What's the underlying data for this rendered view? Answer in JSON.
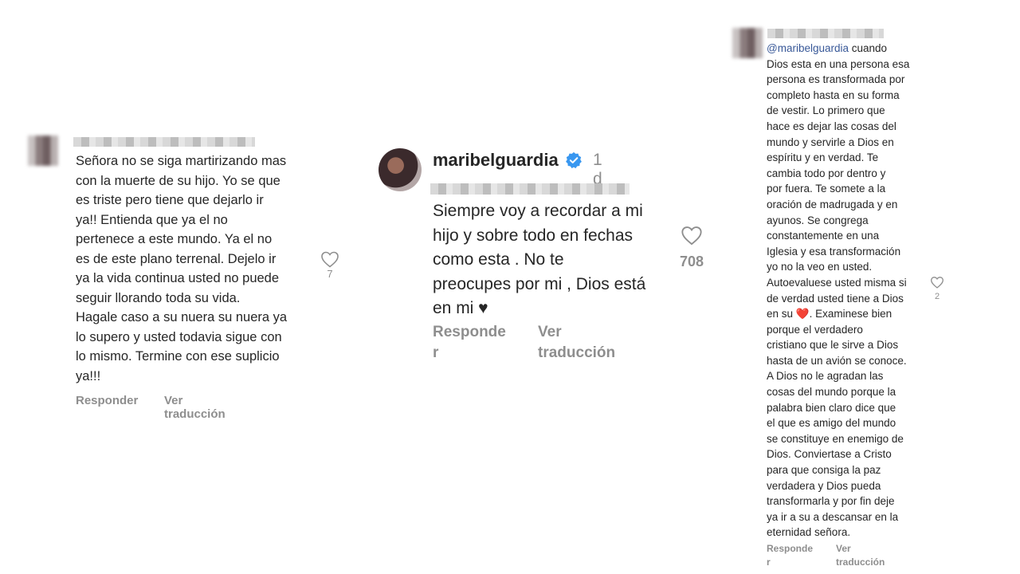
{
  "comment1": {
    "text": "Señora no se siga martirizando mas\ncon la muerte de su hijo. Yo se que\nes triste pero tiene que dejarlo ir\nya!! Entienda que ya el no\npertenece a este mundo. Ya el no\nes de este plano terrenal. Dejelo ir\nya la vida continua usted no puede\nseguir llorando toda su vida.\nHagale caso a su nuera su nuera ya\nlo supero y usted todavia sigue con\nlo mismo. Termine con ese suplicio\nya!!!",
    "likes": "7",
    "reply_label": "Responder",
    "translate_label": "Ver traducción"
  },
  "comment2": {
    "username": "maribelguardia",
    "time": "1 d",
    "text": "Siempre voy a recordar a mi\nhijo y sobre todo en fechas\ncomo esta . No te\npreocupes por mi , Dios está\nen mi ♥",
    "likes": "708",
    "reply_label": "Responder",
    "translate_label": "Ver traducción"
  },
  "comment3": {
    "mention": "@maribelguardia",
    "text_before_heart": " cuando\nDios esta en una persona esa\npersona es transformada por\ncompleto hasta en su forma\nde vestir. Lo primero que\nhace es dejar las cosas del\nmundo y servirle a Dios en\nespíritu y en verdad. Te\ncambia todo por dentro y\npor fuera. Te somete a la\noración de madrugada y en\nayunos. Se congrega\nconstantemente en una\nIglesia y esa transformación\nyo no la veo en usted.\nAutoevaluese usted misma si\nde verdad usted tiene a Dios\nen su ",
    "heart": "❤️",
    "text_after_heart": ". Examinese bien\nporque el verdadero\ncristiano que le sirve a Dios\nhasta de un avión se conoce.\nA Dios no le agradan las\ncosas del mundo porque la\npalabra bien claro dice que\nel que es amigo del mundo\nse constituye en enemigo de\nDios. Conviertase a Cristo\npara que consiga la paz\nverdadera y Dios pueda\ntransformarla y por fin deje\nya ir a su a descansar en la\neternidad señora.",
    "likes": "2",
    "reply_label": "Responde\nr",
    "translate_label": "Ver\ntraducción"
  },
  "icons": {
    "like": "heart-outline-icon",
    "verified": "verified-badge-icon"
  },
  "colors": {
    "verified_blue": "#3897f0",
    "secondary_text": "#8e8e8e",
    "mention": "#385898",
    "heart_red": "#e0242d"
  }
}
